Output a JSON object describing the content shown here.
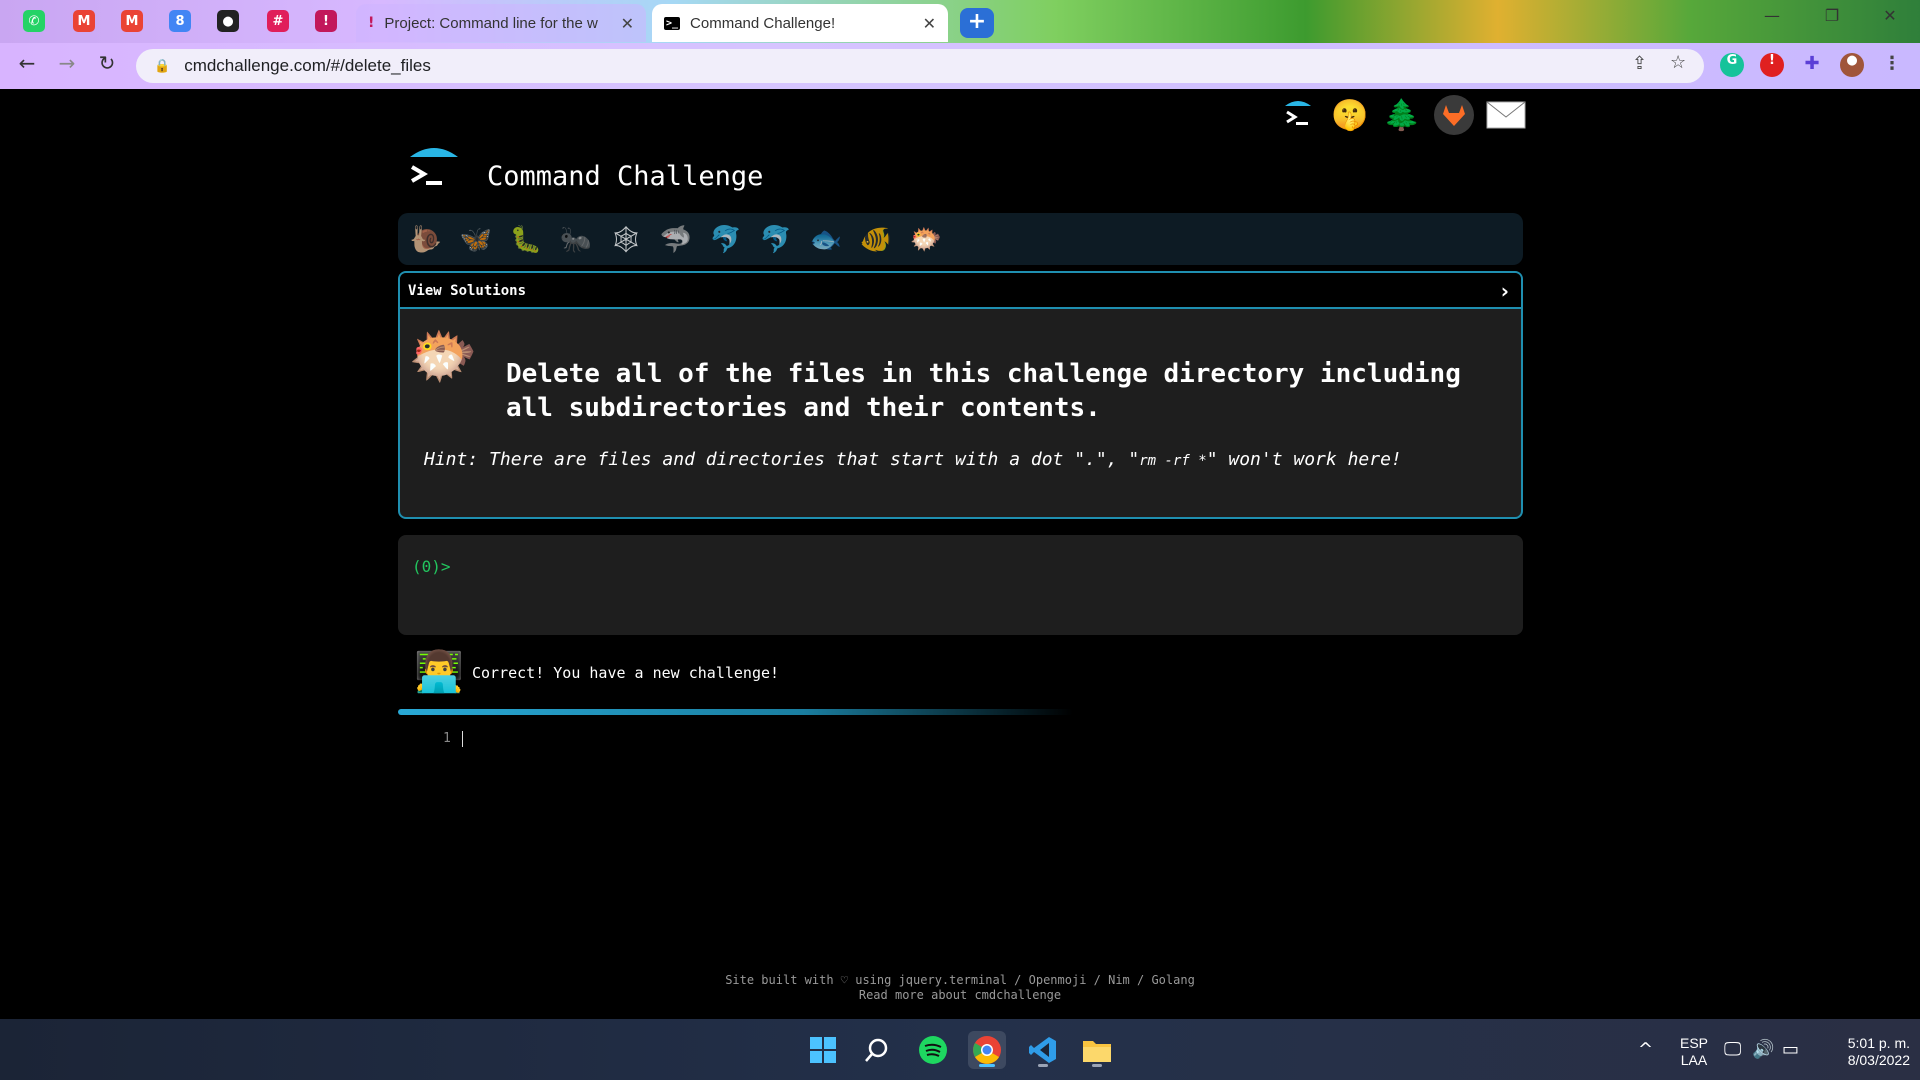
{
  "browser": {
    "pinned_tabs": [
      {
        "name": "whatsapp-icon",
        "glyph": "✆",
        "color": "#25d366"
      },
      {
        "name": "gmail-icon",
        "glyph": "M",
        "color": "#ea4335"
      },
      {
        "name": "gmail-icon-2",
        "glyph": "M",
        "color": "#ea4335"
      },
      {
        "name": "calendar-icon",
        "glyph": "8",
        "color": "#4285f4"
      },
      {
        "name": "github-icon",
        "glyph": "●",
        "color": "#222222"
      },
      {
        "name": "slack-icon",
        "glyph": "#",
        "color": "#e01e5a"
      },
      {
        "name": "pin-tab-icon",
        "glyph": "!",
        "color": "#c2185b"
      }
    ],
    "tabs": [
      {
        "title": "Project: Command line for the w",
        "active": false
      },
      {
        "title": "Command Challenge!",
        "active": true
      }
    ],
    "url": "cmdchallenge.com/#/delete_files"
  },
  "page": {
    "title": "Command Challenge",
    "top_icons": [
      "terminal-logo-icon",
      "face-icon",
      "tree-icon",
      "gitlab-icon",
      "mail-icon"
    ],
    "animals": [
      "🐌",
      "🦋",
      "🐛",
      "🐜",
      "🕸",
      "🦈",
      "🐬",
      "🐬",
      "🐟",
      "🐠",
      "🐡"
    ],
    "view_solutions": "View Solutions",
    "task": "Delete all of the files in this challenge directory including all subdirectories and their contents.",
    "hint": {
      "prefix": "Hint: There are files and directories that start with a dot \".\", \"",
      "code": "rm -rf *",
      "suffix": "\" won't work here!"
    },
    "prompt": "(0)>",
    "result": "Correct! You have a new challenge!",
    "progress": 0.6,
    "editor_line": "1",
    "footer": {
      "line1": "Site built with ♡ using jquery.terminal / Openmoji / Nim / Golang",
      "line2": "Read more about cmdchallenge"
    }
  },
  "taskbar": {
    "language": "ESP",
    "layout": "LAA",
    "time": "5:01 p. m.",
    "date": "8/03/2022"
  },
  "colors": {
    "accent": "#1f8fb0",
    "prompt_green": "#22c55e",
    "panel": "#1e1e1e"
  }
}
